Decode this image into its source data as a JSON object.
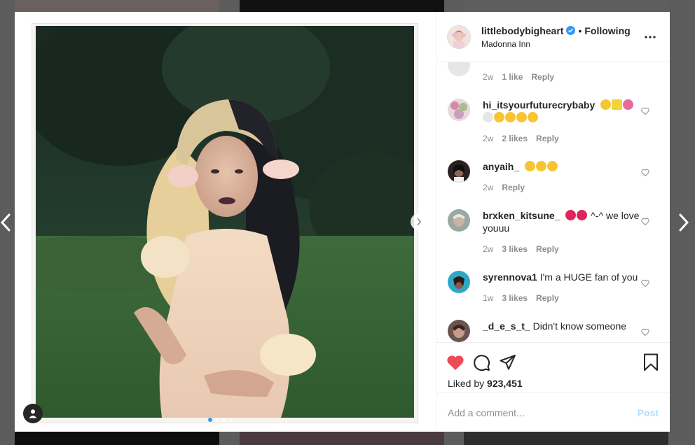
{
  "post": {
    "username": "littlebodybigheart",
    "separator": "•",
    "follow_status": "Following",
    "location": "Madonna Inn"
  },
  "comments": [
    {
      "username": "",
      "text": "",
      "time": "2w",
      "likes": "1 like",
      "reply": "Reply"
    },
    {
      "username": "hi_itsyourfuturecrybaby",
      "text": "",
      "time": "2w",
      "likes": "2 likes",
      "reply": "Reply"
    },
    {
      "username": "anyaih_",
      "text": "",
      "time": "2w",
      "likes": "",
      "reply": "Reply"
    },
    {
      "username": "brxken_kitsune_",
      "text": "^-^ we love youuu",
      "time": "2w",
      "likes": "3 likes",
      "reply": "Reply"
    },
    {
      "username": "syrennova1",
      "text": "I'm a HUGE fan of you",
      "time": "1w",
      "likes": "3 likes",
      "reply": "Reply"
    },
    {
      "username": "_d_e_s_t_",
      "text": "Didn't know someone",
      "time": "",
      "likes": "",
      "reply": ""
    }
  ],
  "likes": {
    "prefix": "Liked by",
    "count": "923,451"
  },
  "comment_input": {
    "placeholder": "Add a comment...",
    "post_label": "Post"
  },
  "colors": {
    "like_red": "#ed4956",
    "link_blue": "#3897f0",
    "post_disabled": "#b2dffc"
  },
  "icons": [
    "chevron-left-icon",
    "chevron-right-icon",
    "verified-badge-icon",
    "more-icon",
    "heart-icon",
    "comment-icon",
    "share-icon",
    "bookmark-icon",
    "tag-user-icon"
  ]
}
